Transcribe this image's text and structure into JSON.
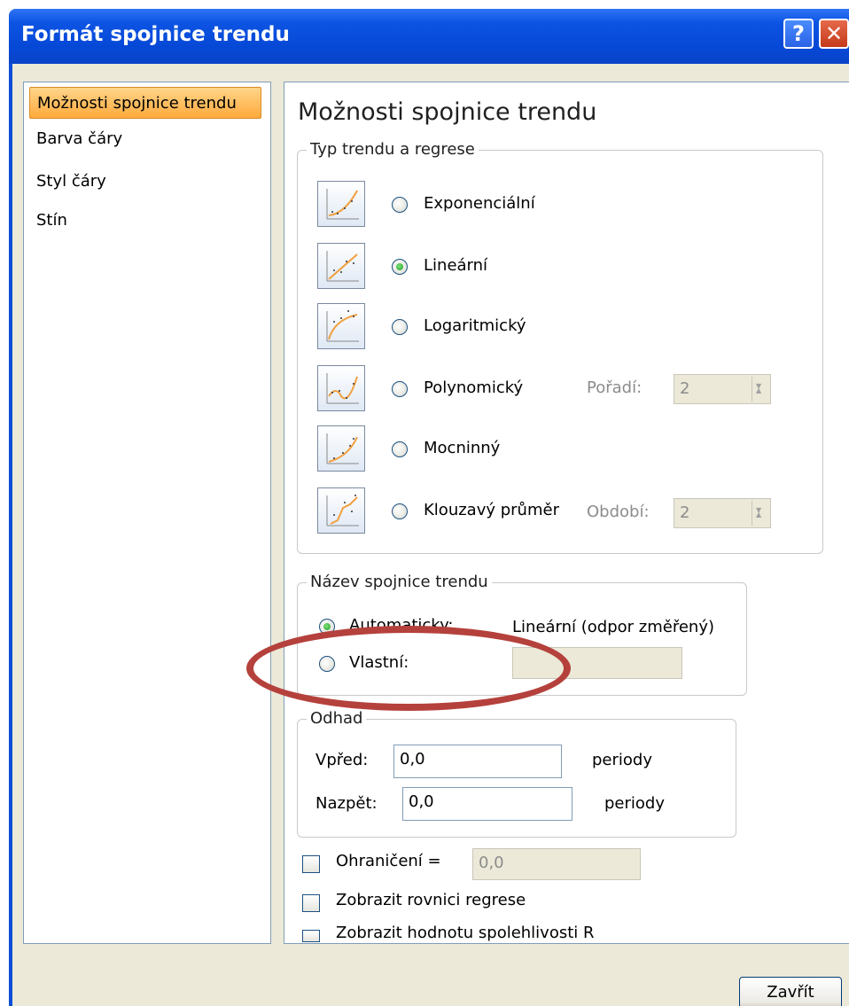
{
  "window": {
    "title": "Formát spojnice trendu",
    "help_glyph": "?",
    "close_glyph": "✕"
  },
  "nav": {
    "items": [
      "Možnosti spojnice trendu",
      "Barva čáry",
      "Styl čáry",
      "Stín"
    ]
  },
  "panel": {
    "heading": "Možnosti spojnice trendu",
    "trend_group": {
      "legend": "Typ trendu a regrese",
      "options": [
        {
          "label": "Exponenciální",
          "selected": false
        },
        {
          "label": "Lineární",
          "selected": true
        },
        {
          "label": "Logaritmický",
          "selected": false
        },
        {
          "label": "Polynomický",
          "selected": false
        },
        {
          "label": "Mocninný",
          "selected": false
        },
        {
          "label": "Klouzavý průměr",
          "selected": false
        }
      ],
      "order_label": "Pořadí:",
      "order_value": "2",
      "period_label": "Období:",
      "period_value": "2"
    },
    "name_group": {
      "legend": "Název spojnice trendu",
      "auto_label": "Automaticky:",
      "auto_value": "Lineární (odpor změřený)",
      "custom_label": "Vlastní:",
      "custom_value": ""
    },
    "forecast_group": {
      "legend": "Odhad",
      "forward_label": "Vpřed:",
      "forward_value": "0,0",
      "forward_unit": "periody",
      "backward_label": "Nazpět:",
      "backward_value": "0,0",
      "backward_unit": "periody"
    },
    "checks": {
      "intercept_label": "Ohraničení =",
      "intercept_value": "0,0",
      "equation_label": "Zobrazit rovnici regrese",
      "rsquared_label": "Zobrazit hodnotu spolehlivosti R"
    }
  },
  "buttons": {
    "close_label": "Zavřít"
  },
  "colors": {
    "title_bar": "#0a4fd6",
    "nav_selected": "#ffaa3c",
    "highlight_ellipse": "#b5413c"
  }
}
